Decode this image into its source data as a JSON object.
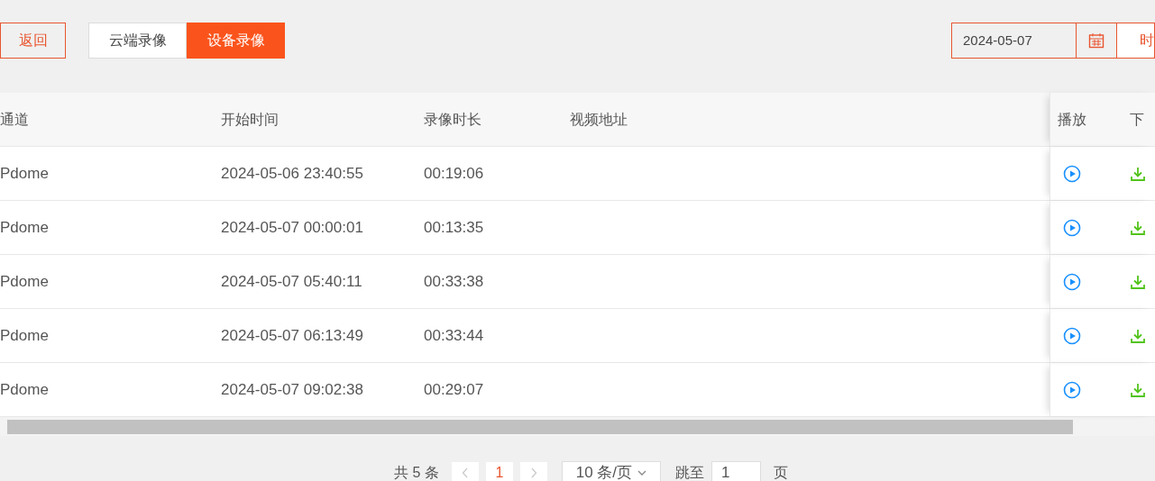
{
  "top_bar": {
    "back_button": "返回",
    "tabs": [
      {
        "label": "云端录像",
        "selected": false
      },
      {
        "label": "设备录像",
        "selected": true
      }
    ],
    "date_field": {
      "value": "2024-05-07"
    },
    "time_button": "时"
  },
  "table": {
    "columns": [
      "通道",
      "开始时间",
      "录像时长",
      "视频地址"
    ],
    "action_columns": [
      "播放",
      "下"
    ],
    "rows": [
      {
        "channel": "Pdome",
        "start": "2024-05-06 23:40:55",
        "duration": "00:19:06"
      },
      {
        "channel": "Pdome",
        "start": "2024-05-07 00:00:01",
        "duration": "00:13:35"
      },
      {
        "channel": "Pdome",
        "start": "2024-05-07 05:40:11",
        "duration": "00:33:38"
      },
      {
        "channel": "Pdome",
        "start": "2024-05-07 06:13:49",
        "duration": "00:33:44"
      },
      {
        "channel": "Pdome",
        "start": "2024-05-07 09:02:38",
        "duration": "00:29:07"
      }
    ]
  },
  "pagination": {
    "total": "共 5 条",
    "pages": [
      {
        "label": "1",
        "selected": true
      }
    ],
    "page_size": "10 条/页",
    "jump_label": "跳至",
    "jump_value": "1",
    "page_suffix": "页"
  }
}
